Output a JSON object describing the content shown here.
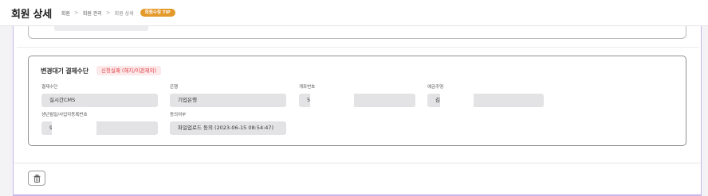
{
  "header": {
    "title": "회원 상세",
    "breadcrumb": [
      "회원",
      "회원 관리",
      "회원 상세"
    ],
    "tip_badge": "회원수정 TIP"
  },
  "method_card": {
    "title": "변경대기 결제수단",
    "status_badge": "신청실패 (해지/이관제외)",
    "fields": {
      "payment_method": {
        "label": "결제수단",
        "value": "실시간CMS"
      },
      "bank": {
        "label": "은행",
        "value": "기업은행"
      },
      "account_number": {
        "label": "계좌번호",
        "value": "5"
      },
      "account_holder": {
        "label": "예금주명",
        "value": "김"
      },
      "birth_or_bizno": {
        "label": "생년월일/사업자등록번호",
        "value": "9"
      },
      "consent": {
        "label": "동의여부",
        "value": "파일업로드 동의 (2023-06-15 08:54:47)"
      }
    }
  },
  "icons": {
    "delete": "trash-icon"
  },
  "colors": {
    "accent_border": "#c9b7ea",
    "tip_badge": "#e49a2b",
    "status_text": "#e0434a",
    "status_bg": "#fde9e9"
  }
}
